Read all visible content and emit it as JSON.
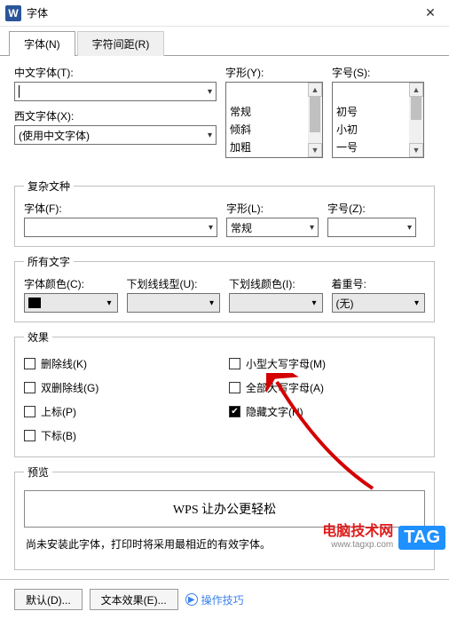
{
  "title": {
    "icon": "W",
    "text": "字体"
  },
  "tabs": {
    "font": "字体(N)",
    "spacing": "字符间距(R)"
  },
  "section1": {
    "cn_font_label": "中文字体(T):",
    "cn_font_value": "",
    "en_font_label": "西文字体(X):",
    "en_font_value": "(使用中文字体)",
    "style_label": "字形(Y):",
    "style_options": [
      "常规",
      "倾斜",
      "加粗"
    ],
    "size_label": "字号(S):",
    "size_options": [
      "初号",
      "小初",
      "一号"
    ]
  },
  "complex": {
    "legend": "复杂文种",
    "font_label": "字体(F):",
    "font_value": "",
    "style_label": "字形(L):",
    "style_value": "常规",
    "size_label": "字号(Z):",
    "size_value": ""
  },
  "alltext": {
    "legend": "所有文字",
    "color_label": "字体颜色(C):",
    "color_value": "",
    "underline_style_label": "下划线线型(U):",
    "underline_style_value": "",
    "underline_color_label": "下划线颜色(I):",
    "underline_color_value": "",
    "emphasis_label": "着重号:",
    "emphasis_value": "(无)"
  },
  "effects": {
    "legend": "效果",
    "strike": "删除线(K)",
    "dblstrike": "双删除线(G)",
    "super": "上标(P)",
    "sub": "下标(B)",
    "smallcaps": "小型大写字母(M)",
    "allcaps": "全部大写字母(A)",
    "hidden": "隐藏文字(H)"
  },
  "preview": {
    "legend": "预览",
    "text": "WPS 让办公更轻松",
    "note": "尚未安装此字体，打印时将采用最相近的有效字体。"
  },
  "footer": {
    "default_btn": "默认(D)...",
    "texteffect_btn": "文本效果(E)...",
    "tips": "操作技巧"
  },
  "overlay": {
    "site1": "电脑技术网",
    "site1b": "www.tagxp.com",
    "tag": "TAG"
  }
}
